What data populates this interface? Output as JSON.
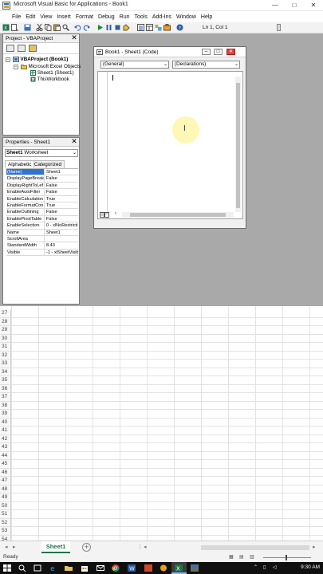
{
  "window": {
    "title": "Microsoft Visual Basic for Applications - Book1",
    "minimize": "—",
    "maximize": "□",
    "close": "✕"
  },
  "menu": [
    {
      "label": "File",
      "key": "F"
    },
    {
      "label": "Edit",
      "key": "E"
    },
    {
      "label": "View",
      "key": "V"
    },
    {
      "label": "Insert",
      "key": "I"
    },
    {
      "label": "Format",
      "key": "o"
    },
    {
      "label": "Debug",
      "key": "D"
    },
    {
      "label": "Run",
      "key": "R"
    },
    {
      "label": "Tools",
      "key": "T"
    },
    {
      "label": "Add-Ins",
      "key": "A"
    },
    {
      "label": "Window",
      "key": "W"
    },
    {
      "label": "Help",
      "key": "H"
    }
  ],
  "toolbar": {
    "position": "Ln 1, Col 1"
  },
  "project": {
    "title": "Project - VBAProject",
    "close": "✕",
    "tree": {
      "root": "VBAProject (Book1)",
      "folder": "Microsoft Excel Objects",
      "items": [
        "Sheet1 (Sheet1)",
        "ThisWorkbook"
      ]
    }
  },
  "properties": {
    "title": "Properties - Sheet1",
    "close": "✕",
    "object_name": "Sheet1",
    "object_type": "Worksheet",
    "tabs": [
      "Alphabetic",
      "Categorized"
    ],
    "rows": [
      {
        "k": "(Name)",
        "v": "Sheet1"
      },
      {
        "k": "DisplayPageBreak",
        "v": "False"
      },
      {
        "k": "DisplayRightToLef",
        "v": "False"
      },
      {
        "k": "EnableAutoFilter",
        "v": "False"
      },
      {
        "k": "EnableCalculation",
        "v": "True"
      },
      {
        "k": "EnableFormatCon",
        "v": "True"
      },
      {
        "k": "EnableOutlining",
        "v": "False"
      },
      {
        "k": "EnablePivotTable",
        "v": "False"
      },
      {
        "k": "EnableSelection",
        "v": "0 - xlNoRestricti"
      },
      {
        "k": "Name",
        "v": "Sheet1"
      },
      {
        "k": "ScrollArea",
        "v": ""
      },
      {
        "k": "StandardWidth",
        "v": "8.43"
      },
      {
        "k": "Visible",
        "v": "-1 - xlSheetVisib"
      }
    ]
  },
  "code_window": {
    "title": "Book1 - Sheet1 (Code)",
    "object_combo": "(General)",
    "proc_combo": "(Declarations)"
  },
  "sheet": {
    "rows": [
      "27",
      "28",
      "29",
      "30",
      "31",
      "32",
      "33",
      "34",
      "35",
      "36",
      "37",
      "38",
      "39",
      "40",
      "41",
      "42",
      "43",
      "44",
      "45",
      "46",
      "47",
      "48",
      "49",
      "50",
      "51",
      "52",
      "53",
      "54"
    ],
    "tab": "Sheet1",
    "add": "+"
  },
  "status": {
    "text": "Ready"
  },
  "taskbar": {
    "time": "9:30 AM"
  },
  "colors": {
    "excel_green": "#217346",
    "selection_blue": "#3173d4",
    "vbe_background": "#a9a9a9"
  }
}
